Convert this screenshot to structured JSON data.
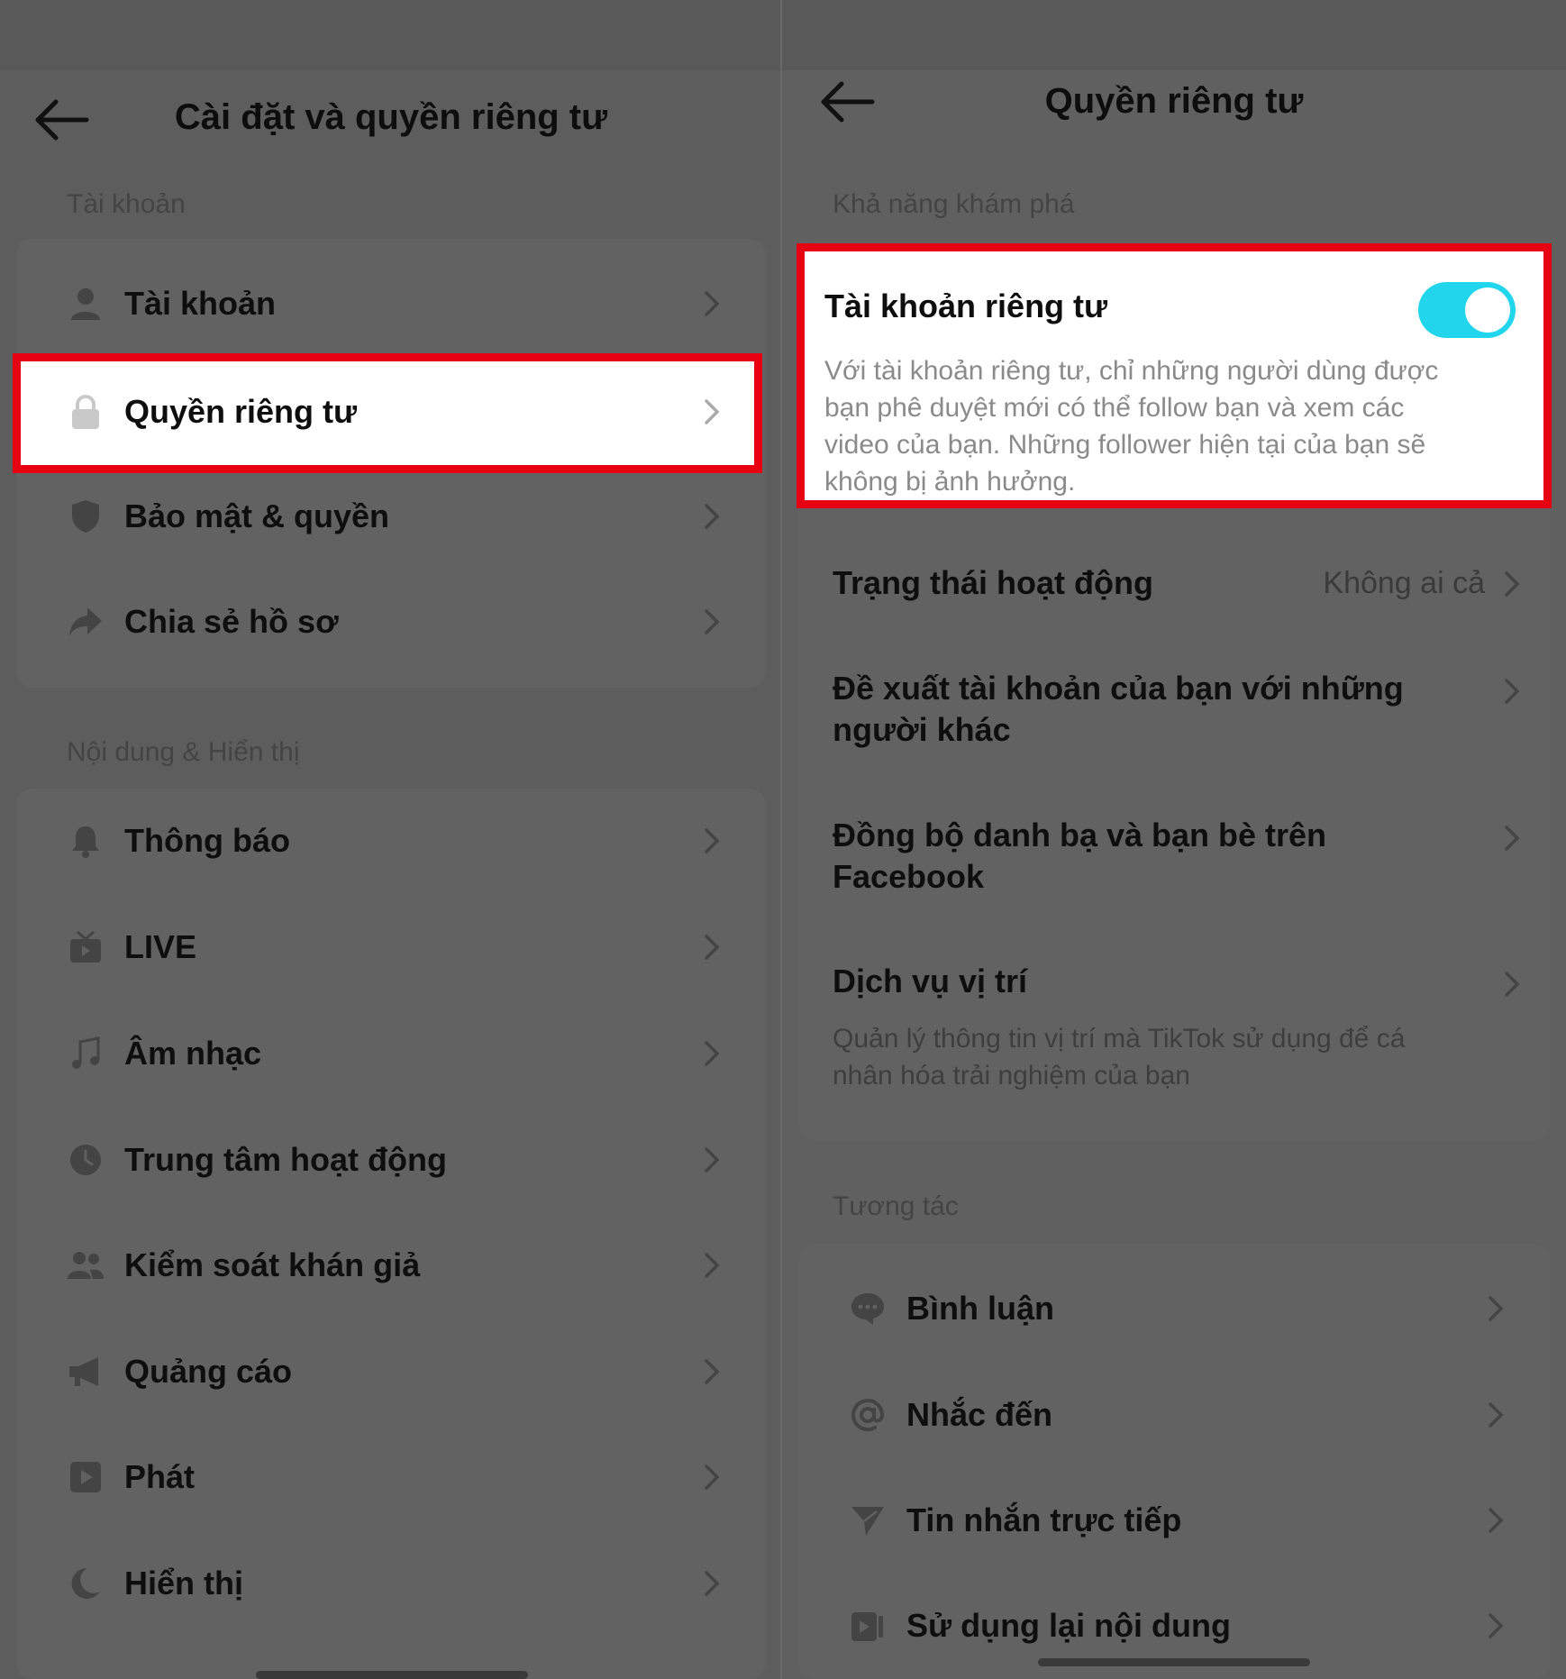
{
  "colors": {
    "highlight_border": "#e60012",
    "toggle_on": "#20d5ec",
    "dim_overlay": "#5f5f5f"
  },
  "left": {
    "title": "Cài đặt và quyền riêng tư",
    "account_section": {
      "label": "Tài khoản",
      "items": [
        {
          "label": "Tài khoản",
          "icon": "person-icon"
        },
        {
          "label": "Quyền riêng tư",
          "icon": "lock-icon",
          "highlighted": true
        },
        {
          "label": "Bảo mật & quyền",
          "icon": "shield-icon"
        },
        {
          "label": "Chia sẻ hồ sơ",
          "icon": "share-icon"
        }
      ]
    },
    "content_section": {
      "label": "Nội dung & Hiển thị",
      "items": [
        {
          "label": "Thông báo",
          "icon": "bell-icon"
        },
        {
          "label": "LIVE",
          "icon": "tv-icon"
        },
        {
          "label": "Âm nhạc",
          "icon": "music-note-icon"
        },
        {
          "label": "Trung tâm hoạt động",
          "icon": "clock-icon"
        },
        {
          "label": "Kiểm soát khán giả",
          "icon": "people-icon"
        },
        {
          "label": "Quảng cáo",
          "icon": "megaphone-icon"
        },
        {
          "label": "Phát",
          "icon": "play-icon"
        },
        {
          "label": "Hiển thị",
          "icon": "moon-icon"
        }
      ]
    }
  },
  "right": {
    "title": "Quyền riêng tư",
    "discoverability": {
      "label": "Khả năng khám phá",
      "private_account": {
        "label": "Tài khoản riêng tư",
        "description_lines": [
          "Với tài khoản riêng tư, chỉ những người dùng được",
          "bạn phê duyệt mới có thể follow bạn và xem các",
          "video của bạn. Những follower hiện tại của bạn sẽ",
          "không bị ảnh hưởng."
        ],
        "toggle_on": true
      },
      "activity_status": {
        "label": "Trạng thái hoạt động",
        "value": "Không ai cả"
      },
      "suggest_account": {
        "lines": [
          "Đề xuất tài khoản của bạn với những",
          "người khác"
        ]
      },
      "sync_contacts": {
        "lines": [
          "Đồng bộ danh bạ và bạn bè trên",
          "Facebook"
        ]
      },
      "location": {
        "label": "Dịch vụ vị trí",
        "description_lines": [
          "Quản lý thông tin vị trí mà TikTok sử dụng để cá",
          "nhân hóa trải nghiệm của bạn"
        ]
      }
    },
    "interactions": {
      "label": "Tương tác",
      "items": [
        {
          "label": "Bình luận",
          "icon": "comment-icon"
        },
        {
          "label": "Nhắc đến",
          "icon": "at-icon"
        },
        {
          "label": "Tin nhắn trực tiếp",
          "icon": "send-icon"
        },
        {
          "label": "Sử dụng lại nội dung",
          "icon": "reuse-icon"
        }
      ]
    }
  }
}
